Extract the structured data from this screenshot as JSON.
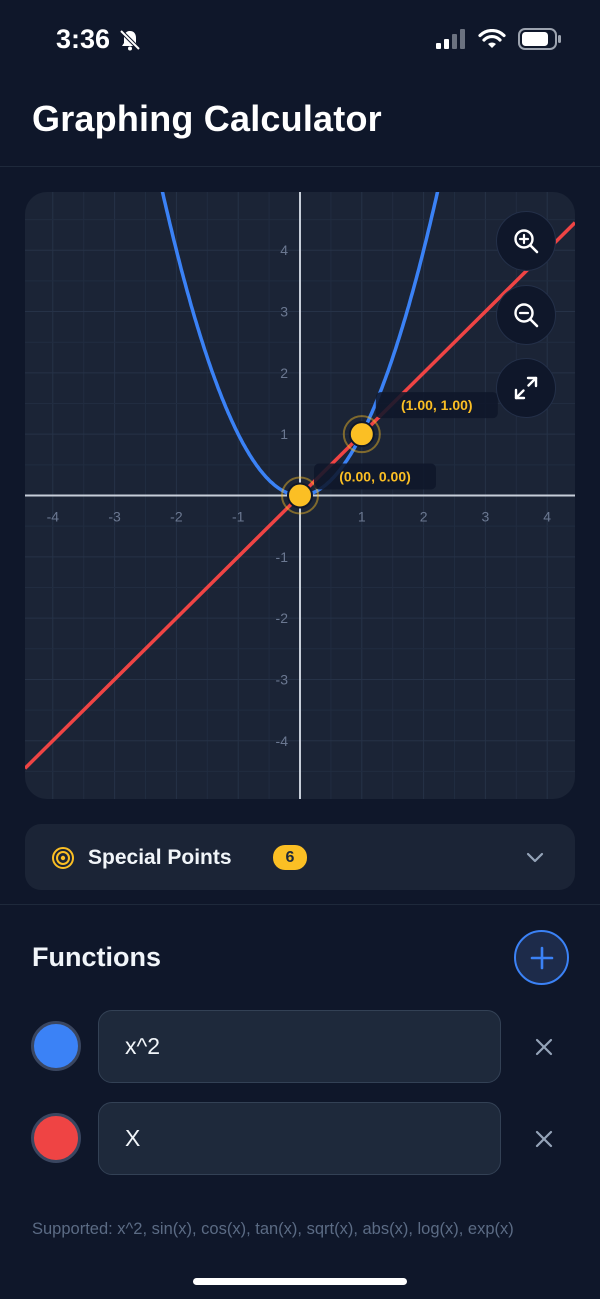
{
  "status_bar": {
    "time": "3:36"
  },
  "header": {
    "title": "Graphing Calculator"
  },
  "graph": {
    "x_range": [
      -4.45,
      4.45
    ],
    "y_range": [
      -4.95,
      4.95
    ],
    "x_ticks": [
      "-4",
      "-3",
      "-2",
      "-1",
      "1",
      "2",
      "3",
      "4"
    ],
    "y_ticks": [
      "4",
      "3",
      "2",
      "1",
      "-1",
      "-2",
      "-3",
      "-4"
    ],
    "curve_colors": {
      "x^2": "#3b82f6",
      "X": "#ef4444"
    },
    "point_color": "#fbbf24",
    "points": [
      {
        "x": 0,
        "y": 0,
        "label": "(0.00, 0.00)"
      },
      {
        "x": 1,
        "y": 1,
        "label": "(1.00, 1.00)"
      }
    ],
    "controls": [
      "zoom-in-icon",
      "zoom-out-icon",
      "expand-icon"
    ]
  },
  "special_points": {
    "label": "Special Points",
    "count": "6"
  },
  "functions": {
    "title": "Functions",
    "items": [
      {
        "expr": "x^2",
        "color": "#3b82f6"
      },
      {
        "expr": "X",
        "color": "#ef4444"
      }
    ]
  },
  "footer": {
    "supported": "Supported: x^2, sin(x), cos(x), tan(x), sqrt(x), abs(x), log(x), exp(x)"
  }
}
